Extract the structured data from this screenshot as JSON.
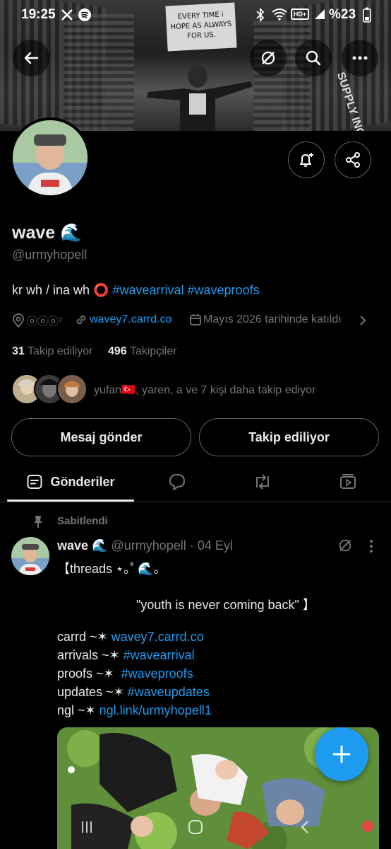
{
  "status_bar": {
    "time": "19:25",
    "battery": "%23"
  },
  "banner": {
    "sign_line1": "EVERY TIME i",
    "sign_line2": "HOPE AS ALWAYS",
    "sign_line3": "FOR US.",
    "side_text": "SUPPLY INC."
  },
  "profile": {
    "name": "wave 🌊",
    "handle": "@urmyhopell",
    "bio_plain": "kr wh / ina wh ⭕ ",
    "bio_tag1": "#wavearrival",
    "bio_tag2": "#waveproofs",
    "location": "ⓞⓞⓞ⁷",
    "website": "wavey7.carrd.co",
    "joined": "Mayıs 2026 tarihinde katıldı",
    "following_count": "31",
    "following_label": "Takip ediliyor",
    "followers_count": "496",
    "followers_label": "Takipçiler",
    "followed_by": "yufan🇹🇷, yaren, a ve 7 kişi daha takip ediyor"
  },
  "actions": {
    "message": "Mesaj gönder",
    "following": "Takip ediliyor"
  },
  "tabs": {
    "posts": "Gönderiler"
  },
  "pinned_post": {
    "pinned_label": "Sabitlendi",
    "name": "wave 🌊",
    "handle": "@urmyhopell",
    "date": "· 04 Eyl",
    "line1": "【threads ⋆｡˚ 🌊｡",
    "line2": "\"youth is never coming back\" 】",
    "carrd_prefix": "carrd ~✶ ",
    "carrd_link": "wavey7.carrd.co",
    "arrivals_prefix": "arrivals ~✶ ",
    "arrivals_link": "#wavearrival",
    "proofs_prefix": "proofs ~✶  ",
    "proofs_link": "#waveproofs",
    "updates_prefix": "updates ~✶ ",
    "updates_link": "#waveupdates",
    "ngl_prefix": "ngl ~✶ ",
    "ngl_link": "ngl.link/urmyhopell1"
  },
  "colors": {
    "accent": "#1d9bf0",
    "background": "#000000",
    "text": "#e7e9ea",
    "muted": "#71767b"
  }
}
